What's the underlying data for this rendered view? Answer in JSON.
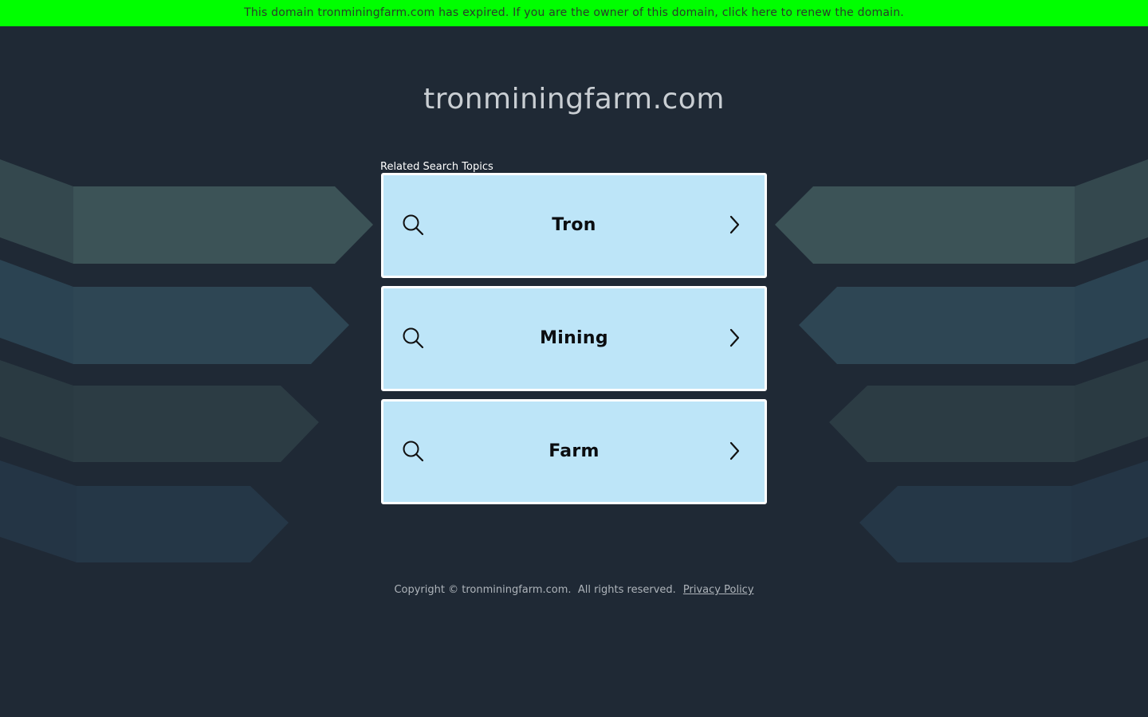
{
  "banner": {
    "text": "This domain tronminingfarm.com has expired. If you are the owner of this domain, click here to renew the domain."
  },
  "header": {
    "domain": "tronminingfarm.com"
  },
  "related": {
    "label": "Related Search Topics",
    "topics": [
      {
        "label": "Tron",
        "icon": "search-icon",
        "arrow": "chevron-right-icon"
      },
      {
        "label": "Mining",
        "icon": "search-icon",
        "arrow": "chevron-right-icon"
      },
      {
        "label": "Farm",
        "icon": "search-icon",
        "arrow": "chevron-right-icon"
      }
    ]
  },
  "footer": {
    "copyright": "Copyright © tronminingfarm.com.  All rights reserved.",
    "privacy_label": "Privacy Policy"
  },
  "colors": {
    "banner_bg": "#00ff00",
    "page_bg": "#1f2935",
    "topic_bg": "#bde5f8",
    "topic_border": "#ffffff"
  }
}
